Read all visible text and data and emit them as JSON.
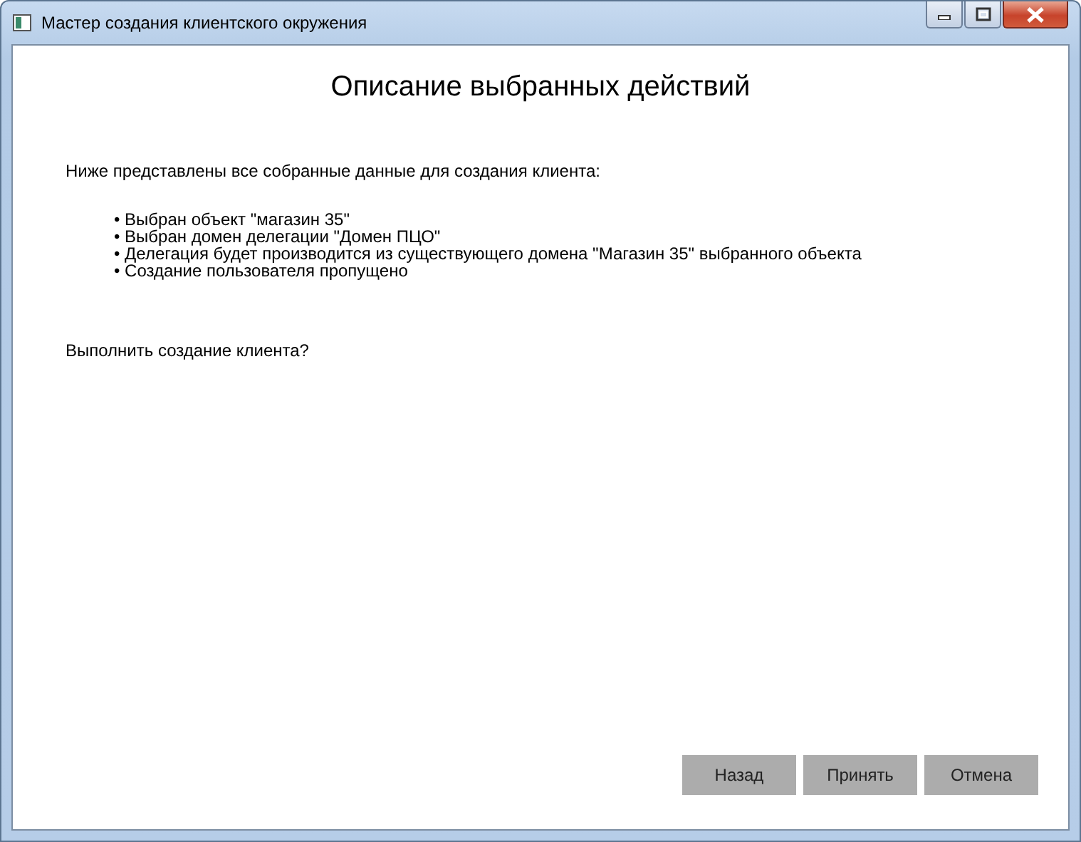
{
  "window": {
    "title": "Мастер создания клиентского окружения"
  },
  "heading": "Описание выбранных действий",
  "intro": "Ниже представлены все собранные данные для создания клиента:",
  "summary": [
    "• Выбран объект \"магазин 35\"",
    "• Выбран домен делегации \"Домен ПЦО\"",
    "• Делегация будет производится из существующего домена \"Магазин 35\" выбранного объекта",
    "• Создание пользователя пропущено"
  ],
  "question": "Выполнить создание клиента?",
  "buttons": [
    {
      "label": "Назад"
    },
    {
      "label": "Принять"
    },
    {
      "label": "Отмена"
    }
  ]
}
